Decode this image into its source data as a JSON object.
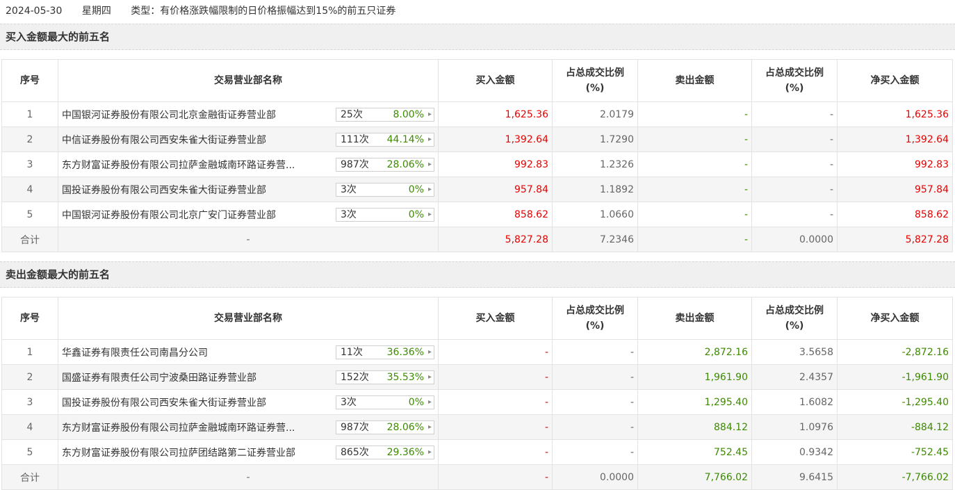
{
  "header": {
    "date": "2024-05-30",
    "weekday": "星期四",
    "type_label": "类型：",
    "type_value": "有价格涨跌幅限制的日价格振幅达到15%的前五只证券"
  },
  "columns": {
    "seq": "序号",
    "dept": "交易营业部名称",
    "buy": "买入金额",
    "buy_ratio_1": "占总成交比例",
    "buy_ratio_2": "(%)",
    "sell": "卖出金额",
    "sell_ratio_1": "占总成交比例",
    "sell_ratio_2": "(%)",
    "net": "净买入金额"
  },
  "buy_section": {
    "title": "买入金额最大的前五名",
    "rows": [
      {
        "seq": "1",
        "dept": "中国银河证券股份有限公司北京金融街证券营业部",
        "count": "25次",
        "pct": "8.00%",
        "buy": "1,625.36",
        "buy_ratio": "2.0179",
        "sell": "-",
        "sell_ratio": "-",
        "net": "1,625.36"
      },
      {
        "seq": "2",
        "dept": "中信证券股份有限公司西安朱雀大街证券营业部",
        "count": "111次",
        "pct": "44.14%",
        "buy": "1,392.64",
        "buy_ratio": "1.7290",
        "sell": "-",
        "sell_ratio": "-",
        "net": "1,392.64"
      },
      {
        "seq": "3",
        "dept": "东方财富证券股份有限公司拉萨金融城南环路证券营...",
        "count": "987次",
        "pct": "28.06%",
        "buy": "992.83",
        "buy_ratio": "1.2326",
        "sell": "-",
        "sell_ratio": "-",
        "net": "992.83"
      },
      {
        "seq": "4",
        "dept": "国投证券股份有限公司西安朱雀大街证券营业部",
        "count": "3次",
        "pct": "0%",
        "buy": "957.84",
        "buy_ratio": "1.1892",
        "sell": "-",
        "sell_ratio": "-",
        "net": "957.84"
      },
      {
        "seq": "5",
        "dept": "中国银河证券股份有限公司北京广安门证券营业部",
        "count": "3次",
        "pct": "0%",
        "buy": "858.62",
        "buy_ratio": "1.0660",
        "sell": "-",
        "sell_ratio": "-",
        "net": "858.62"
      }
    ],
    "total": {
      "label": "合计",
      "dept": "-",
      "buy": "5,827.28",
      "buy_ratio": "7.2346",
      "sell": "-",
      "sell_ratio": "0.0000",
      "net": "5,827.28"
    }
  },
  "sell_section": {
    "title": "卖出金额最大的前五名",
    "rows": [
      {
        "seq": "1",
        "dept": "华鑫证券有限责任公司南昌分公司",
        "count": "11次",
        "pct": "36.36%",
        "buy": "-",
        "buy_ratio": "-",
        "sell": "2,872.16",
        "sell_ratio": "3.5658",
        "net": "-2,872.16"
      },
      {
        "seq": "2",
        "dept": "国盛证券有限责任公司宁波桑田路证券营业部",
        "count": "152次",
        "pct": "35.53%",
        "buy": "-",
        "buy_ratio": "-",
        "sell": "1,961.90",
        "sell_ratio": "2.4357",
        "net": "-1,961.90"
      },
      {
        "seq": "3",
        "dept": "国投证券股份有限公司西安朱雀大街证券营业部",
        "count": "3次",
        "pct": "0%",
        "buy": "-",
        "buy_ratio": "-",
        "sell": "1,295.40",
        "sell_ratio": "1.6082",
        "net": "-1,295.40"
      },
      {
        "seq": "4",
        "dept": "东方财富证券股份有限公司拉萨金融城南环路证券营...",
        "count": "987次",
        "pct": "28.06%",
        "buy": "-",
        "buy_ratio": "-",
        "sell": "884.12",
        "sell_ratio": "1.0976",
        "net": "-884.12"
      },
      {
        "seq": "5",
        "dept": "东方财富证券股份有限公司拉萨团结路第二证券营业部",
        "count": "865次",
        "pct": "29.36%",
        "buy": "-",
        "buy_ratio": "-",
        "sell": "752.45",
        "sell_ratio": "0.9342",
        "net": "-752.45"
      }
    ],
    "total": {
      "label": "合计",
      "dept": "-",
      "buy": "-",
      "buy_ratio": "0.0000",
      "sell": "7,766.02",
      "sell_ratio": "9.6415",
      "net": "-7,766.02"
    }
  },
  "colors": {
    "up": "#e60000",
    "down": "#3c8a00",
    "neutral": "#333333"
  },
  "icons": {
    "chip_arrow": "caret-right-icon"
  }
}
